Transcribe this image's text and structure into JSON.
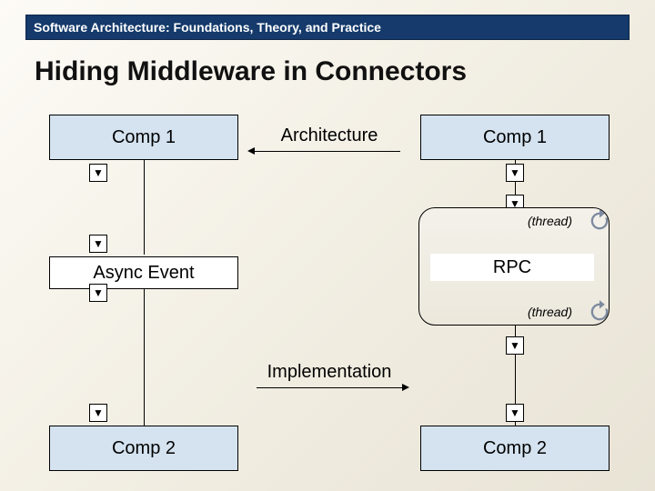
{
  "header": {
    "text": "Software Architecture: Foundations, Theory, and Practice"
  },
  "title": "Hiding Middleware in Connectors",
  "labels": {
    "architecture": "Architecture",
    "implementation": "Implementation"
  },
  "left": {
    "comp1": "Comp 1",
    "async": "Async Event",
    "comp2": "Comp 2"
  },
  "right": {
    "comp1": "Comp 1",
    "rpc": "RPC",
    "comp2": "Comp 2",
    "thread1": "(thread)",
    "thread2": "(thread)"
  },
  "icons": {
    "triangle": "▼"
  },
  "colors": {
    "headerBg": "#153a6b",
    "compFill": "#d5e3f0"
  }
}
